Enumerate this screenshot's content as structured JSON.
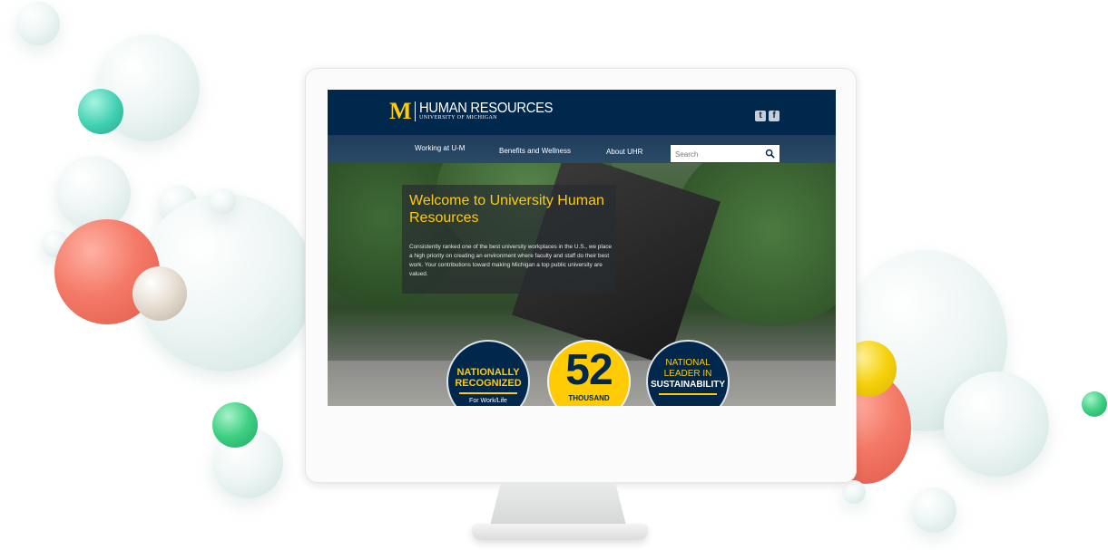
{
  "site": {
    "logo_letter": "M",
    "title": "HUMAN RESOURCES",
    "subtitle": "UNIVERSITY OF MICHIGAN"
  },
  "social": [
    {
      "icon": "twitter-icon",
      "glyph": "t"
    },
    {
      "icon": "facebook-icon",
      "glyph": "f"
    }
  ],
  "nav": {
    "items": [
      {
        "label": "Working at U-M"
      },
      {
        "label": "Benefits and Wellness"
      },
      {
        "label": "About UHR"
      }
    ]
  },
  "search": {
    "placeholder": "Search"
  },
  "hero": {
    "title": "Welcome to University Human Resources",
    "body": "Consistently ranked one of the best university workplaces in the U.S., we place a high priority on creating an environment where faculty and staff do their best work. Your contributions toward making Michigan a top public university are valued."
  },
  "badges": {
    "recognized": {
      "line1": "NATIONALLY",
      "line2": "RECOGNIZED",
      "line3": "For Work/Life"
    },
    "employees": {
      "number": "52",
      "unit": "THOUSAND"
    },
    "sustainability": {
      "line1": "NATIONAL",
      "line2": "LEADER IN",
      "line3": "SUSTAINABILITY"
    }
  },
  "colors": {
    "brand_navy": "#00274c",
    "brand_maize": "#ffcb05"
  }
}
